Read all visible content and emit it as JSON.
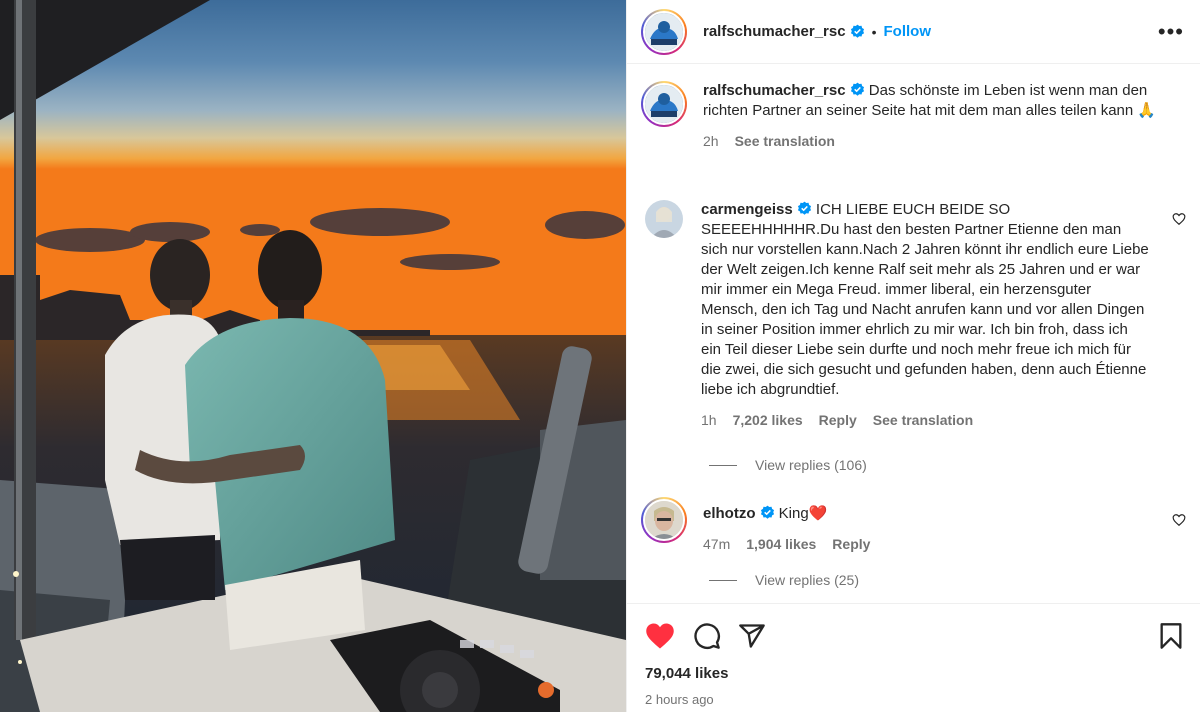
{
  "post": {
    "author": "ralfschumacher_rsc",
    "follow_label": "Follow",
    "dot": "•",
    "more": "•••"
  },
  "caption": {
    "author": "ralfschumacher_rsc",
    "text": "Das schönste im Leben ist wenn man den richten Partner an seiner Seite hat mit dem man alles teilen kann",
    "emoji": "🙏",
    "time": "2h",
    "see_translation": "See translation"
  },
  "comments": [
    {
      "author": "carmengeiss",
      "text": "ICH LIEBE EUCH BEIDE SO SEEEEHHHHHR.Du hast den besten Partner Etienne den man sich nur vorstellen kann.Nach 2 Jahren könnt ihr endlich eure Liebe der Welt zeigen.Ich kenne Ralf seit mehr als 25 Jahren und er war mir immer ein Mega Freud. immer liberal, ein herzensguter Mensch, den ich Tag und Nacht anrufen kann und vor allen Dingen in seiner Position immer ehrlich zu mir war. Ich bin froh, dass ich ein Teil dieser Liebe sein durfte und noch mehr freue ich mich für die zwei, die sich gesucht und gefunden haben, denn auch Étienne liebe ich abgrundtief.",
      "time": "1h",
      "likes": "7,202 likes",
      "reply": "Reply",
      "see_translation": "See translation",
      "view_replies": "View replies (106)"
    },
    {
      "author": "elhotzo",
      "text": "King",
      "emoji": "❤️",
      "time": "47m",
      "likes": "1,904 likes",
      "reply": "Reply",
      "view_replies": "View replies (25)"
    }
  ],
  "footer": {
    "likes": "79,044 likes",
    "time_ago": "2 hours ago"
  },
  "colors": {
    "accent": "#0095f6",
    "like_red": "#ff3040",
    "verified": "#0095f6",
    "muted": "#737373"
  },
  "icons": [
    "more-icon",
    "verified-icon",
    "heart-icon",
    "comment-icon",
    "share-icon",
    "bookmark-icon"
  ]
}
